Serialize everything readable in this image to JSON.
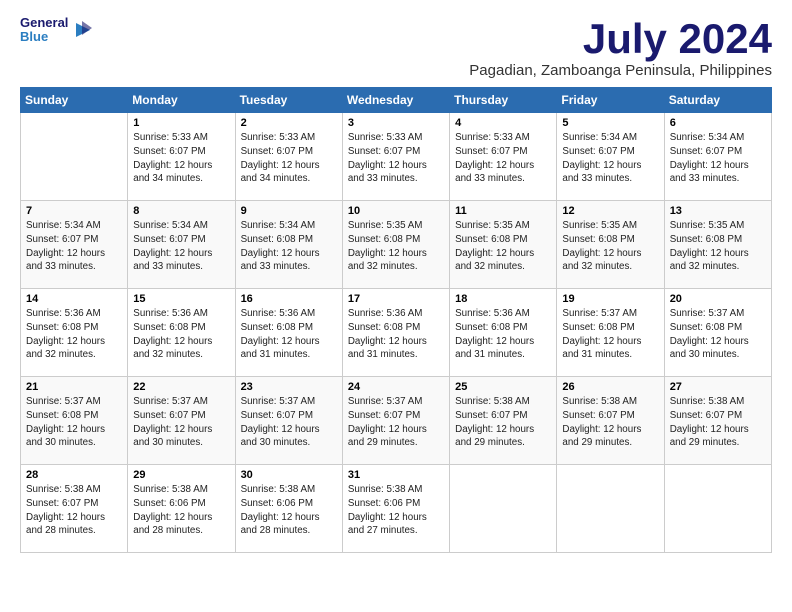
{
  "header": {
    "logo_line1": "General",
    "logo_line2": "Blue",
    "month_year": "July 2024",
    "location": "Pagadian, Zamboanga Peninsula, Philippines"
  },
  "weekdays": [
    "Sunday",
    "Monday",
    "Tuesday",
    "Wednesday",
    "Thursday",
    "Friday",
    "Saturday"
  ],
  "weeks": [
    [
      {
        "day": "",
        "info": ""
      },
      {
        "day": "1",
        "info": "Sunrise: 5:33 AM\nSunset: 6:07 PM\nDaylight: 12 hours\nand 34 minutes."
      },
      {
        "day": "2",
        "info": "Sunrise: 5:33 AM\nSunset: 6:07 PM\nDaylight: 12 hours\nand 34 minutes."
      },
      {
        "day": "3",
        "info": "Sunrise: 5:33 AM\nSunset: 6:07 PM\nDaylight: 12 hours\nand 33 minutes."
      },
      {
        "day": "4",
        "info": "Sunrise: 5:33 AM\nSunset: 6:07 PM\nDaylight: 12 hours\nand 33 minutes."
      },
      {
        "day": "5",
        "info": "Sunrise: 5:34 AM\nSunset: 6:07 PM\nDaylight: 12 hours\nand 33 minutes."
      },
      {
        "day": "6",
        "info": "Sunrise: 5:34 AM\nSunset: 6:07 PM\nDaylight: 12 hours\nand 33 minutes."
      }
    ],
    [
      {
        "day": "7",
        "info": "Sunrise: 5:34 AM\nSunset: 6:07 PM\nDaylight: 12 hours\nand 33 minutes."
      },
      {
        "day": "8",
        "info": "Sunrise: 5:34 AM\nSunset: 6:07 PM\nDaylight: 12 hours\nand 33 minutes."
      },
      {
        "day": "9",
        "info": "Sunrise: 5:34 AM\nSunset: 6:08 PM\nDaylight: 12 hours\nand 33 minutes."
      },
      {
        "day": "10",
        "info": "Sunrise: 5:35 AM\nSunset: 6:08 PM\nDaylight: 12 hours\nand 32 minutes."
      },
      {
        "day": "11",
        "info": "Sunrise: 5:35 AM\nSunset: 6:08 PM\nDaylight: 12 hours\nand 32 minutes."
      },
      {
        "day": "12",
        "info": "Sunrise: 5:35 AM\nSunset: 6:08 PM\nDaylight: 12 hours\nand 32 minutes."
      },
      {
        "day": "13",
        "info": "Sunrise: 5:35 AM\nSunset: 6:08 PM\nDaylight: 12 hours\nand 32 minutes."
      }
    ],
    [
      {
        "day": "14",
        "info": "Sunrise: 5:36 AM\nSunset: 6:08 PM\nDaylight: 12 hours\nand 32 minutes."
      },
      {
        "day": "15",
        "info": "Sunrise: 5:36 AM\nSunset: 6:08 PM\nDaylight: 12 hours\nand 32 minutes."
      },
      {
        "day": "16",
        "info": "Sunrise: 5:36 AM\nSunset: 6:08 PM\nDaylight: 12 hours\nand 31 minutes."
      },
      {
        "day": "17",
        "info": "Sunrise: 5:36 AM\nSunset: 6:08 PM\nDaylight: 12 hours\nand 31 minutes."
      },
      {
        "day": "18",
        "info": "Sunrise: 5:36 AM\nSunset: 6:08 PM\nDaylight: 12 hours\nand 31 minutes."
      },
      {
        "day": "19",
        "info": "Sunrise: 5:37 AM\nSunset: 6:08 PM\nDaylight: 12 hours\nand 31 minutes."
      },
      {
        "day": "20",
        "info": "Sunrise: 5:37 AM\nSunset: 6:08 PM\nDaylight: 12 hours\nand 30 minutes."
      }
    ],
    [
      {
        "day": "21",
        "info": "Sunrise: 5:37 AM\nSunset: 6:08 PM\nDaylight: 12 hours\nand 30 minutes."
      },
      {
        "day": "22",
        "info": "Sunrise: 5:37 AM\nSunset: 6:07 PM\nDaylight: 12 hours\nand 30 minutes."
      },
      {
        "day": "23",
        "info": "Sunrise: 5:37 AM\nSunset: 6:07 PM\nDaylight: 12 hours\nand 30 minutes."
      },
      {
        "day": "24",
        "info": "Sunrise: 5:37 AM\nSunset: 6:07 PM\nDaylight: 12 hours\nand 29 minutes."
      },
      {
        "day": "25",
        "info": "Sunrise: 5:38 AM\nSunset: 6:07 PM\nDaylight: 12 hours\nand 29 minutes."
      },
      {
        "day": "26",
        "info": "Sunrise: 5:38 AM\nSunset: 6:07 PM\nDaylight: 12 hours\nand 29 minutes."
      },
      {
        "day": "27",
        "info": "Sunrise: 5:38 AM\nSunset: 6:07 PM\nDaylight: 12 hours\nand 29 minutes."
      }
    ],
    [
      {
        "day": "28",
        "info": "Sunrise: 5:38 AM\nSunset: 6:07 PM\nDaylight: 12 hours\nand 28 minutes."
      },
      {
        "day": "29",
        "info": "Sunrise: 5:38 AM\nSunset: 6:06 PM\nDaylight: 12 hours\nand 28 minutes."
      },
      {
        "day": "30",
        "info": "Sunrise: 5:38 AM\nSunset: 6:06 PM\nDaylight: 12 hours\nand 28 minutes."
      },
      {
        "day": "31",
        "info": "Sunrise: 5:38 AM\nSunset: 6:06 PM\nDaylight: 12 hours\nand 27 minutes."
      },
      {
        "day": "",
        "info": ""
      },
      {
        "day": "",
        "info": ""
      },
      {
        "day": "",
        "info": ""
      }
    ]
  ]
}
